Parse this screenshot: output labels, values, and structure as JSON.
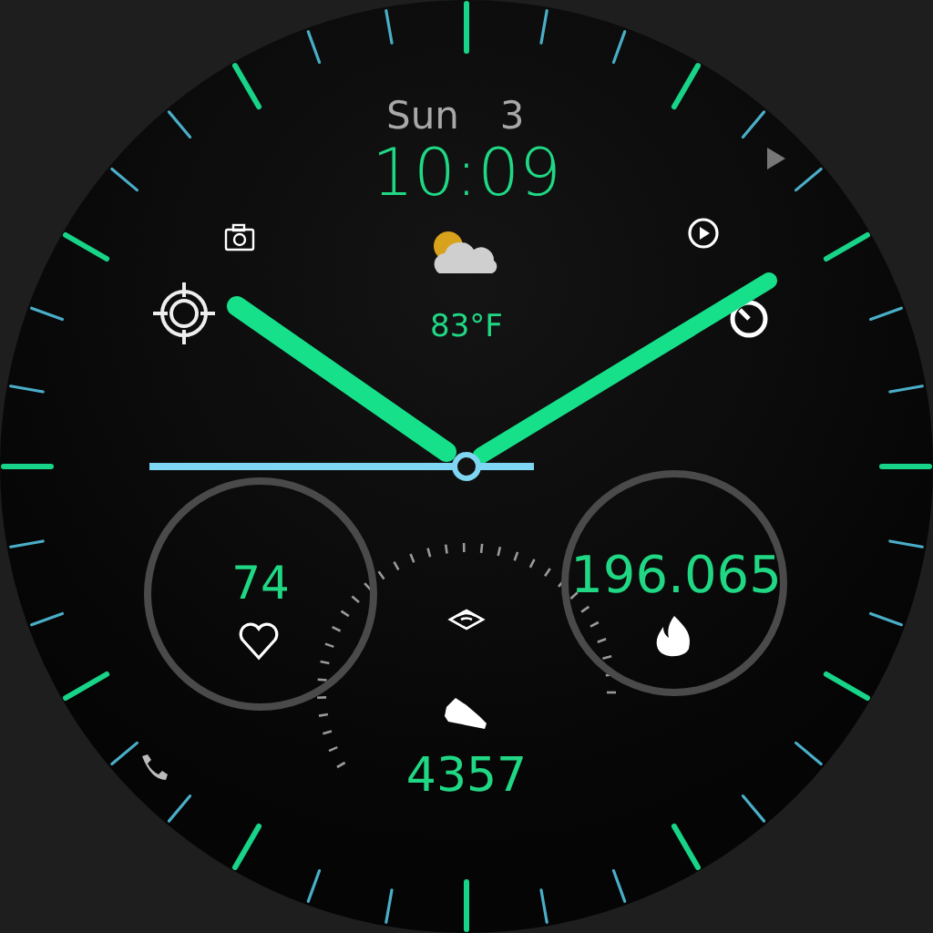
{
  "date": {
    "weekday": "Sun",
    "day": "3"
  },
  "time": "10:09",
  "weather": {
    "temperature": "83°F"
  },
  "heart_rate": {
    "value": "74"
  },
  "calories": {
    "value": "196.065"
  },
  "steps": {
    "value": "4357"
  }
}
